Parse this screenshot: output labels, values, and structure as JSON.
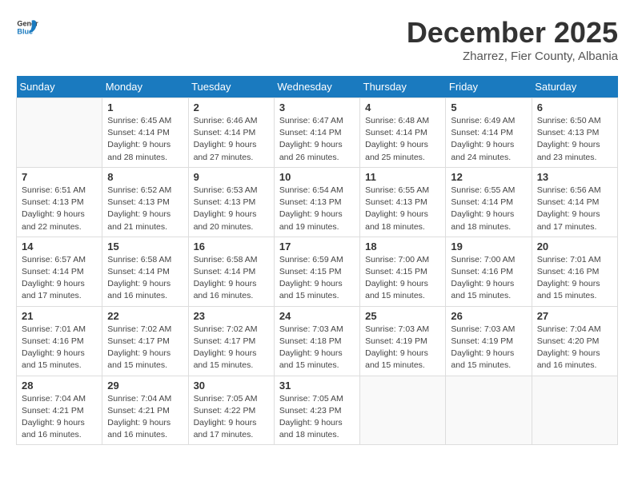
{
  "logo": {
    "general": "General",
    "blue": "Blue"
  },
  "header": {
    "month": "December 2025",
    "location": "Zharrez, Fier County, Albania"
  },
  "weekdays": [
    "Sunday",
    "Monday",
    "Tuesday",
    "Wednesday",
    "Thursday",
    "Friday",
    "Saturday"
  ],
  "weeks": [
    [
      {
        "day": "",
        "sunrise": "",
        "sunset": "",
        "daylight": ""
      },
      {
        "day": "1",
        "sunrise": "Sunrise: 6:45 AM",
        "sunset": "Sunset: 4:14 PM",
        "daylight": "Daylight: 9 hours and 28 minutes."
      },
      {
        "day": "2",
        "sunrise": "Sunrise: 6:46 AM",
        "sunset": "Sunset: 4:14 PM",
        "daylight": "Daylight: 9 hours and 27 minutes."
      },
      {
        "day": "3",
        "sunrise": "Sunrise: 6:47 AM",
        "sunset": "Sunset: 4:14 PM",
        "daylight": "Daylight: 9 hours and 26 minutes."
      },
      {
        "day": "4",
        "sunrise": "Sunrise: 6:48 AM",
        "sunset": "Sunset: 4:14 PM",
        "daylight": "Daylight: 9 hours and 25 minutes."
      },
      {
        "day": "5",
        "sunrise": "Sunrise: 6:49 AM",
        "sunset": "Sunset: 4:14 PM",
        "daylight": "Daylight: 9 hours and 24 minutes."
      },
      {
        "day": "6",
        "sunrise": "Sunrise: 6:50 AM",
        "sunset": "Sunset: 4:13 PM",
        "daylight": "Daylight: 9 hours and 23 minutes."
      }
    ],
    [
      {
        "day": "7",
        "sunrise": "Sunrise: 6:51 AM",
        "sunset": "Sunset: 4:13 PM",
        "daylight": "Daylight: 9 hours and 22 minutes."
      },
      {
        "day": "8",
        "sunrise": "Sunrise: 6:52 AM",
        "sunset": "Sunset: 4:13 PM",
        "daylight": "Daylight: 9 hours and 21 minutes."
      },
      {
        "day": "9",
        "sunrise": "Sunrise: 6:53 AM",
        "sunset": "Sunset: 4:13 PM",
        "daylight": "Daylight: 9 hours and 20 minutes."
      },
      {
        "day": "10",
        "sunrise": "Sunrise: 6:54 AM",
        "sunset": "Sunset: 4:13 PM",
        "daylight": "Daylight: 9 hours and 19 minutes."
      },
      {
        "day": "11",
        "sunrise": "Sunrise: 6:55 AM",
        "sunset": "Sunset: 4:13 PM",
        "daylight": "Daylight: 9 hours and 18 minutes."
      },
      {
        "day": "12",
        "sunrise": "Sunrise: 6:55 AM",
        "sunset": "Sunset: 4:14 PM",
        "daylight": "Daylight: 9 hours and 18 minutes."
      },
      {
        "day": "13",
        "sunrise": "Sunrise: 6:56 AM",
        "sunset": "Sunset: 4:14 PM",
        "daylight": "Daylight: 9 hours and 17 minutes."
      }
    ],
    [
      {
        "day": "14",
        "sunrise": "Sunrise: 6:57 AM",
        "sunset": "Sunset: 4:14 PM",
        "daylight": "Daylight: 9 hours and 17 minutes."
      },
      {
        "day": "15",
        "sunrise": "Sunrise: 6:58 AM",
        "sunset": "Sunset: 4:14 PM",
        "daylight": "Daylight: 9 hours and 16 minutes."
      },
      {
        "day": "16",
        "sunrise": "Sunrise: 6:58 AM",
        "sunset": "Sunset: 4:14 PM",
        "daylight": "Daylight: 9 hours and 16 minutes."
      },
      {
        "day": "17",
        "sunrise": "Sunrise: 6:59 AM",
        "sunset": "Sunset: 4:15 PM",
        "daylight": "Daylight: 9 hours and 15 minutes."
      },
      {
        "day": "18",
        "sunrise": "Sunrise: 7:00 AM",
        "sunset": "Sunset: 4:15 PM",
        "daylight": "Daylight: 9 hours and 15 minutes."
      },
      {
        "day": "19",
        "sunrise": "Sunrise: 7:00 AM",
        "sunset": "Sunset: 4:16 PM",
        "daylight": "Daylight: 9 hours and 15 minutes."
      },
      {
        "day": "20",
        "sunrise": "Sunrise: 7:01 AM",
        "sunset": "Sunset: 4:16 PM",
        "daylight": "Daylight: 9 hours and 15 minutes."
      }
    ],
    [
      {
        "day": "21",
        "sunrise": "Sunrise: 7:01 AM",
        "sunset": "Sunset: 4:16 PM",
        "daylight": "Daylight: 9 hours and 15 minutes."
      },
      {
        "day": "22",
        "sunrise": "Sunrise: 7:02 AM",
        "sunset": "Sunset: 4:17 PM",
        "daylight": "Daylight: 9 hours and 15 minutes."
      },
      {
        "day": "23",
        "sunrise": "Sunrise: 7:02 AM",
        "sunset": "Sunset: 4:17 PM",
        "daylight": "Daylight: 9 hours and 15 minutes."
      },
      {
        "day": "24",
        "sunrise": "Sunrise: 7:03 AM",
        "sunset": "Sunset: 4:18 PM",
        "daylight": "Daylight: 9 hours and 15 minutes."
      },
      {
        "day": "25",
        "sunrise": "Sunrise: 7:03 AM",
        "sunset": "Sunset: 4:19 PM",
        "daylight": "Daylight: 9 hours and 15 minutes."
      },
      {
        "day": "26",
        "sunrise": "Sunrise: 7:03 AM",
        "sunset": "Sunset: 4:19 PM",
        "daylight": "Daylight: 9 hours and 15 minutes."
      },
      {
        "day": "27",
        "sunrise": "Sunrise: 7:04 AM",
        "sunset": "Sunset: 4:20 PM",
        "daylight": "Daylight: 9 hours and 16 minutes."
      }
    ],
    [
      {
        "day": "28",
        "sunrise": "Sunrise: 7:04 AM",
        "sunset": "Sunset: 4:21 PM",
        "daylight": "Daylight: 9 hours and 16 minutes."
      },
      {
        "day": "29",
        "sunrise": "Sunrise: 7:04 AM",
        "sunset": "Sunset: 4:21 PM",
        "daylight": "Daylight: 9 hours and 16 minutes."
      },
      {
        "day": "30",
        "sunrise": "Sunrise: 7:05 AM",
        "sunset": "Sunset: 4:22 PM",
        "daylight": "Daylight: 9 hours and 17 minutes."
      },
      {
        "day": "31",
        "sunrise": "Sunrise: 7:05 AM",
        "sunset": "Sunset: 4:23 PM",
        "daylight": "Daylight: 9 hours and 18 minutes."
      },
      {
        "day": "",
        "sunrise": "",
        "sunset": "",
        "daylight": ""
      },
      {
        "day": "",
        "sunrise": "",
        "sunset": "",
        "daylight": ""
      },
      {
        "day": "",
        "sunrise": "",
        "sunset": "",
        "daylight": ""
      }
    ]
  ]
}
